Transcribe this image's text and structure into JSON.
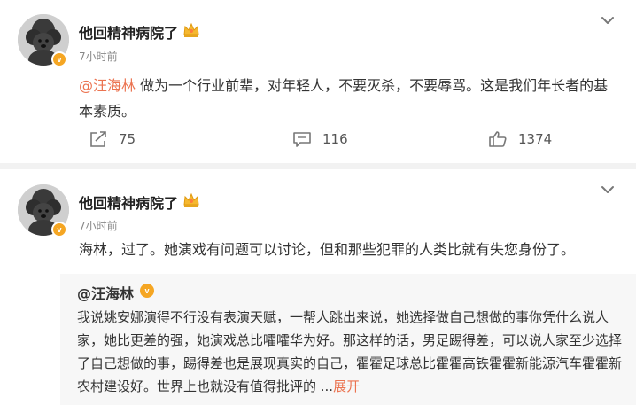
{
  "post1": {
    "username": "他回精神病院了",
    "timestamp": "7小时前",
    "mention": "@汪海林",
    "text": " 做为一个行业前辈，对年轻人，不要灭杀，不要辱骂。这是我们年长者的基本素质。",
    "repost_count": "75",
    "comment_count": "116",
    "like_count": "1374",
    "verified_badge": "v"
  },
  "post2": {
    "username": "他回精神病院了",
    "timestamp": "7小时前",
    "text": "海林，过了。她演戏有问题可以讨论，但和那些犯罪的人类比就有失您身份了。",
    "verified_badge": "v",
    "quoted": {
      "username": "@汪海林",
      "verified_badge": "v",
      "text": "我说姚安娜演得不行没有表演天赋，一帮人跳出来说，她选择做自己想做的事你凭什么说人家，她比更差的强，她演戏总比嚯嚯华为好。那这样的话，男足踢得差，可以说人家至少选择了自己想做的事，踢得差也是展现真实的自己，霍霍足球总比霍霍高铁霍霍新能源汽车霍霍新农村建设好。世界上也就没有值得批评的 ...",
      "expand_label": "展开"
    }
  },
  "icons": {
    "avatar": "poodle-avatar",
    "crown": "crown-icon",
    "more": "chevron-down-icon",
    "repost": "repost-icon",
    "comment": "comment-icon",
    "like": "like-icon"
  },
  "colors": {
    "link": "#eb7350",
    "badge": "#f5a623",
    "background": "#f2f2f2"
  }
}
